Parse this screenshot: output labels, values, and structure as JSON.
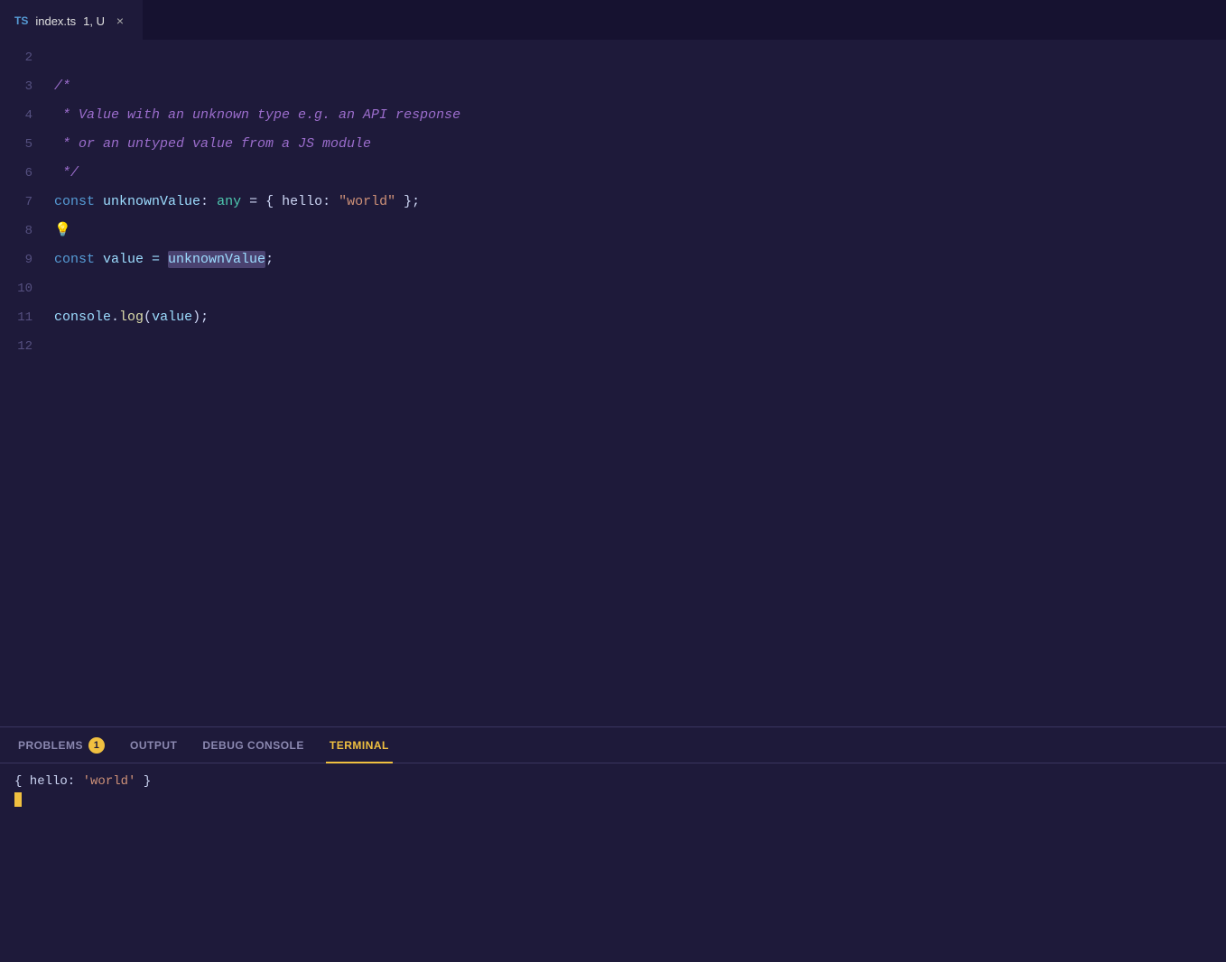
{
  "tab": {
    "lang_label": "TS",
    "filename": "index.ts",
    "modified_label": "1, U",
    "close_label": "×"
  },
  "editor": {
    "lines": [
      {
        "number": "2",
        "content": []
      },
      {
        "number": "3",
        "content": [
          {
            "text": "/*",
            "class": "c-comment"
          }
        ]
      },
      {
        "number": "4",
        "content": [
          {
            "text": " * Value with an unknown type e.g. an API response",
            "class": "c-comment"
          }
        ]
      },
      {
        "number": "5",
        "content": [
          {
            "text": " * or an untyped value from a JS module",
            "class": "c-comment"
          }
        ]
      },
      {
        "number": "6",
        "content": [
          {
            "text": " */",
            "class": "c-comment"
          }
        ]
      },
      {
        "number": "7",
        "content": [
          {
            "text": "const",
            "class": "c-keyword"
          },
          {
            "text": " unknownValue",
            "class": "c-variable"
          },
          {
            "text": ": ",
            "class": "c-punct"
          },
          {
            "text": "any",
            "class": "c-type"
          },
          {
            "text": " = { hello: ",
            "class": "c-punct"
          },
          {
            "text": "\"world\"",
            "class": "c-string"
          },
          {
            "text": " };",
            "class": "c-punct"
          }
        ]
      },
      {
        "number": "8",
        "content": [
          {
            "text": "💡",
            "class": "lightbulb"
          }
        ]
      },
      {
        "number": "9",
        "content": [
          {
            "text": "const",
            "class": "c-keyword"
          },
          {
            "text": " value = ",
            "class": "c-variable"
          },
          {
            "text": "unknownValue",
            "class": "c-variable highlight-word"
          },
          {
            "text": ";",
            "class": "c-punct"
          }
        ]
      },
      {
        "number": "10",
        "content": []
      },
      {
        "number": "11",
        "content": [
          {
            "text": "console",
            "class": "c-variable"
          },
          {
            "text": ".",
            "class": "c-punct"
          },
          {
            "text": "log",
            "class": "c-method"
          },
          {
            "text": "(",
            "class": "c-punct"
          },
          {
            "text": "value",
            "class": "c-variable"
          },
          {
            "text": ");",
            "class": "c-punct"
          }
        ]
      },
      {
        "number": "12",
        "content": []
      }
    ]
  },
  "panel": {
    "tabs": [
      {
        "label": "PROBLEMS",
        "active": false,
        "badge": "1"
      },
      {
        "label": "OUTPUT",
        "active": false,
        "badge": null
      },
      {
        "label": "DEBUG CONSOLE",
        "active": false,
        "badge": null
      },
      {
        "label": "TERMINAL",
        "active": true,
        "badge": null
      }
    ],
    "terminal_output": "{ hello: 'world' }"
  }
}
